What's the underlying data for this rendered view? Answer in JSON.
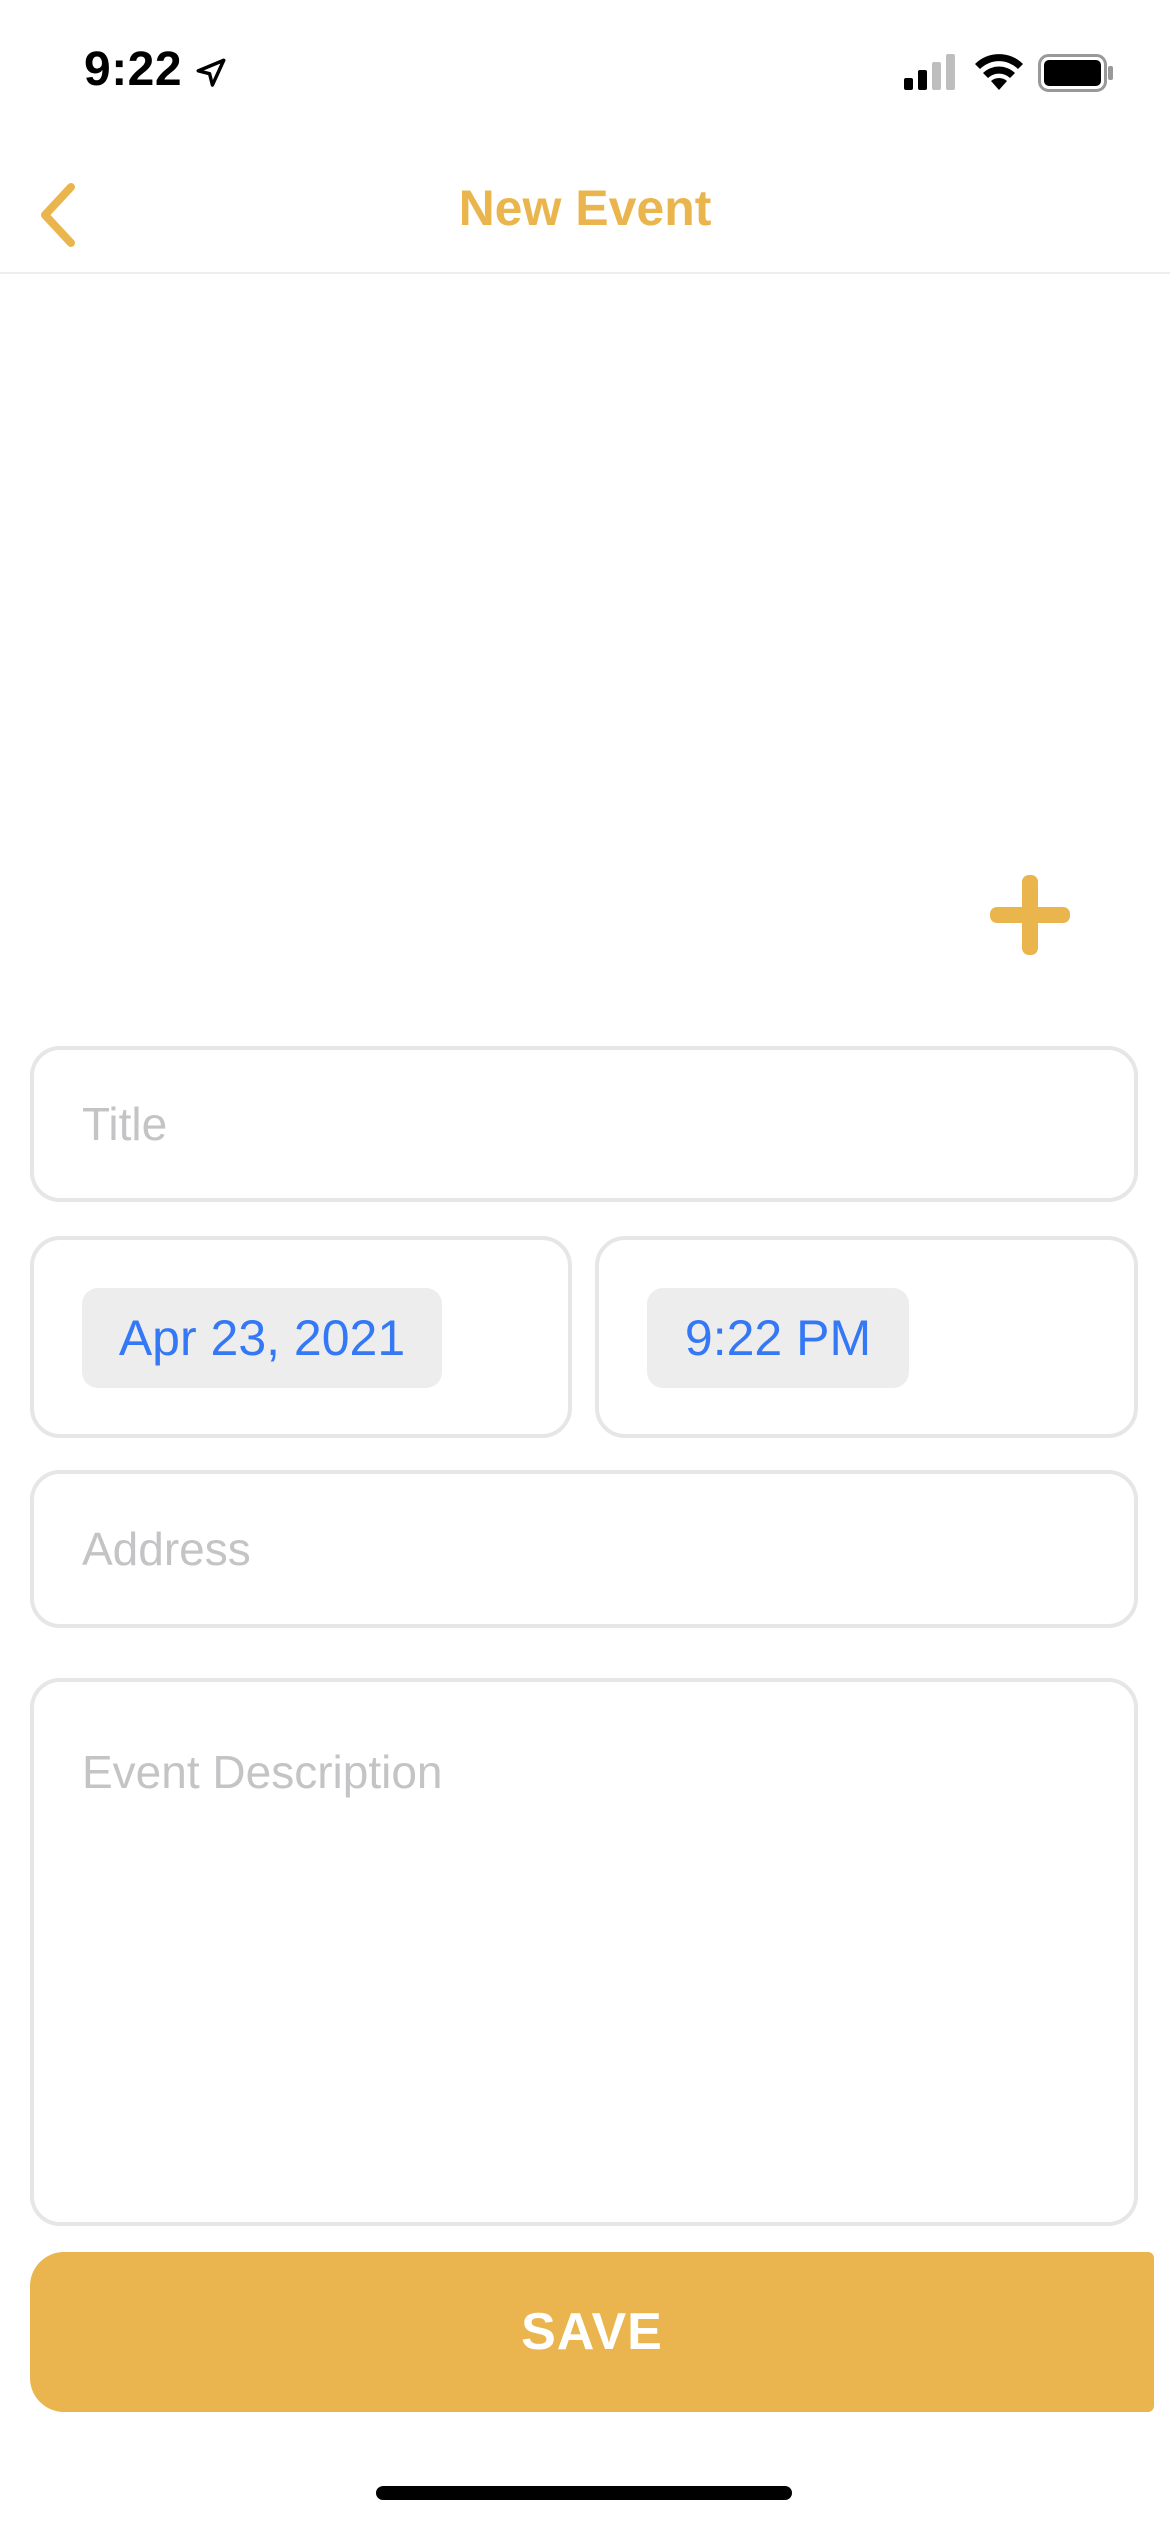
{
  "status_bar": {
    "time": "9:22"
  },
  "nav": {
    "title": "New Event"
  },
  "form": {
    "title_placeholder": "Title",
    "date_value": "Apr 23, 2021",
    "time_value": "9:22 PM",
    "address_placeholder": "Address",
    "description_placeholder": "Event Description",
    "save_label": "SAVE"
  },
  "colors": {
    "accent": "#E9B54C",
    "link_blue": "#3478F6",
    "field_border": "#E6E6E6",
    "placeholder": "#C4C4C6"
  },
  "icons": {
    "status": [
      "location-arrow-icon",
      "signal-icon",
      "wifi-icon",
      "battery-icon"
    ],
    "nav": "chevron-left-icon",
    "add": "plus-icon"
  }
}
